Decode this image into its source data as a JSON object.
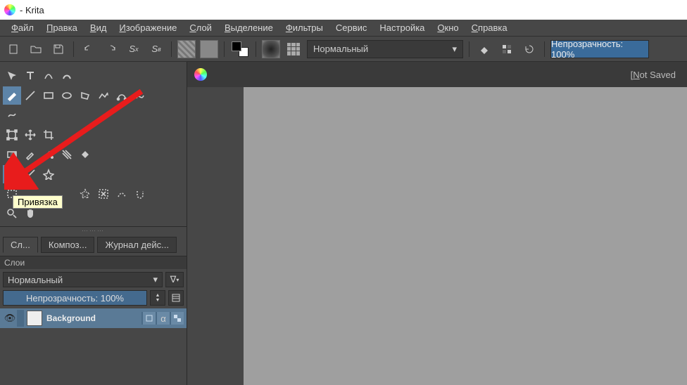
{
  "title": " - Krita",
  "menu": [
    "Файл",
    "Правка",
    "Вид",
    "Изображение",
    "Слой",
    "Выделение",
    "Фильтры",
    "Сервис",
    "Настройка",
    "Окно",
    "Справка"
  ],
  "menu_u": [
    "Ф",
    "П",
    "В",
    "И",
    "С",
    "В",
    "Ф",
    "",
    "",
    "О",
    "С"
  ],
  "blend_mode": "Нормальный",
  "toolbar_opacity": "Непрозрачность: 100%",
  "tooltip": "Привязка",
  "doc_status": "[Not Saved]",
  "doc_status_u": "N",
  "tabs": [
    "Сл...",
    "Композ...",
    "Журнал дейс..."
  ],
  "layers_panel_title": "Слои",
  "layer_blend": "Нормальный",
  "layer_opacity": "Непрозрачность:  100%",
  "layer_name": "Background"
}
